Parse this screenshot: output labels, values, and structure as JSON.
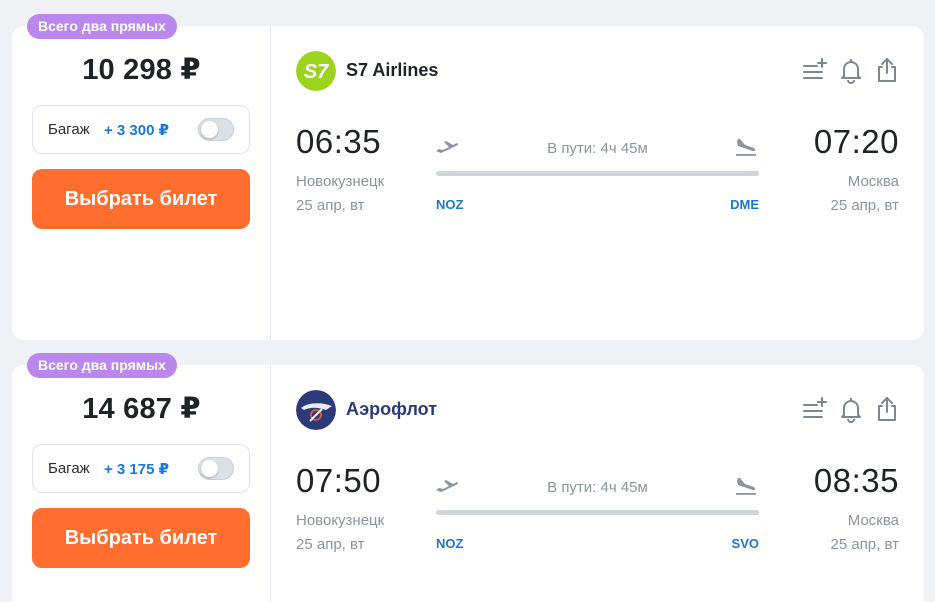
{
  "offers": [
    {
      "badge": "Всего два прямых",
      "price": "10 298 ₽",
      "baggage": {
        "label": "Багаж",
        "surcharge": "+ 3 300 ₽",
        "enabled": false
      },
      "buy_label": "Выбрать билет",
      "airline": {
        "name": "S7 Airlines",
        "logo_text": "S7",
        "logo_color": "#9bd31d"
      },
      "departure": {
        "time": "06:35",
        "city": "Новокузнецк",
        "date": "25 апр, вт",
        "iata": "NOZ"
      },
      "arrival": {
        "time": "07:20",
        "city": "Москва",
        "date": "25 апр, вт",
        "iata": "DME"
      },
      "duration": "В пути: 4ч 45м"
    },
    {
      "badge": "Всего два прямых",
      "price": "14 687 ₽",
      "baggage": {
        "label": "Багаж",
        "surcharge": "+ 3 175 ₽",
        "enabled": false
      },
      "buy_label": "Выбрать билет",
      "airline": {
        "name": "Аэрофлот",
        "logo_color": "#2c3a7a"
      },
      "departure": {
        "time": "07:50",
        "city": "Новокузнецк",
        "date": "25 апр, вт",
        "iata": "NOZ"
      },
      "arrival": {
        "time": "08:35",
        "city": "Москва",
        "date": "25 апр, вт",
        "iata": "SVO"
      },
      "duration": "В пути: 4ч 45м"
    }
  ],
  "icons": [
    "add-to-list-icon",
    "bell-icon",
    "share-icon",
    "takeoff-plane-icon",
    "landing-plane-icon"
  ],
  "colors": {
    "background": "#eff1f4",
    "badge": "#b987ee",
    "buy_button": "#ff6d2f",
    "accent_blue": "#1b76d9",
    "muted_text": "#8d949b",
    "aeroflot_name": "#2c3a7a"
  }
}
